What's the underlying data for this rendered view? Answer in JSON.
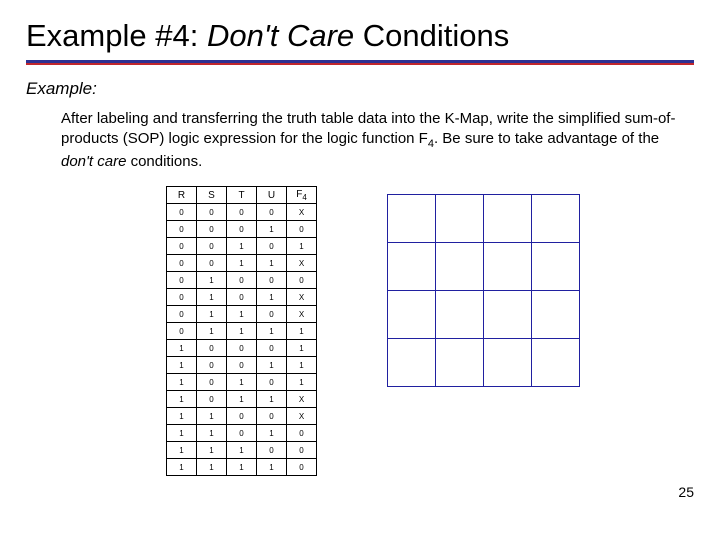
{
  "title": {
    "prefix": "Example #4: ",
    "italic": "Don't Care",
    "suffix": " Conditions"
  },
  "example_label": "Example:",
  "instructions": {
    "line1": "After labeling and transferring the truth table data into the K-Map, write the simplified sum-of-products (SOP) logic expression for the logic function F",
    "sub1": "4",
    "line2": ". Be sure to take advantage of the ",
    "italic": "don't care",
    "line3": " conditions."
  },
  "chart_data": {
    "type": "table",
    "headers": [
      "R",
      "S",
      "T",
      "U",
      "F4"
    ],
    "rows": [
      [
        "0",
        "0",
        "0",
        "0",
        "X"
      ],
      [
        "0",
        "0",
        "0",
        "1",
        "0"
      ],
      [
        "0",
        "0",
        "1",
        "0",
        "1"
      ],
      [
        "0",
        "0",
        "1",
        "1",
        "X"
      ],
      [
        "0",
        "1",
        "0",
        "0",
        "0"
      ],
      [
        "0",
        "1",
        "0",
        "1",
        "X"
      ],
      [
        "0",
        "1",
        "1",
        "0",
        "X"
      ],
      [
        "0",
        "1",
        "1",
        "1",
        "1"
      ],
      [
        "1",
        "0",
        "0",
        "0",
        "1"
      ],
      [
        "1",
        "0",
        "0",
        "1",
        "1"
      ],
      [
        "1",
        "0",
        "1",
        "0",
        "1"
      ],
      [
        "1",
        "0",
        "1",
        "1",
        "X"
      ],
      [
        "1",
        "1",
        "0",
        "0",
        "X"
      ],
      [
        "1",
        "1",
        "0",
        "1",
        "0"
      ],
      [
        "1",
        "1",
        "1",
        "0",
        "0"
      ],
      [
        "1",
        "1",
        "1",
        "1",
        "0"
      ]
    ]
  },
  "kmap": {
    "rows": 4,
    "cols": 4
  },
  "page_number": "25"
}
